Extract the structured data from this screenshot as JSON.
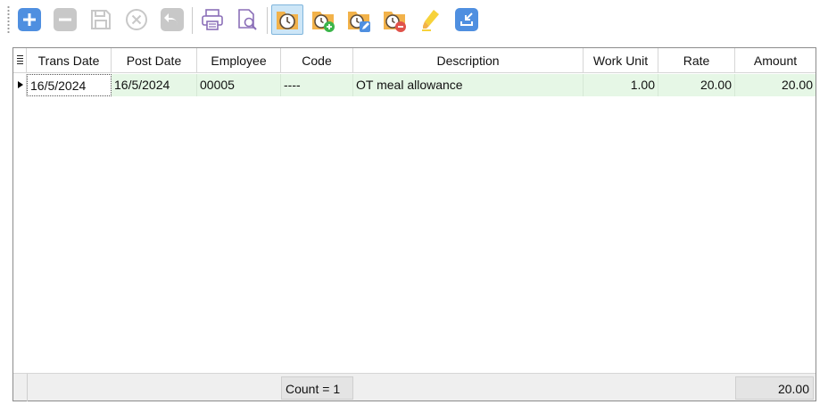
{
  "toolbar": {
    "buttons": [
      {
        "name": "add",
        "icon": "plus-icon",
        "enabled": true
      },
      {
        "name": "delete",
        "icon": "minus-icon",
        "enabled": false
      },
      {
        "name": "save",
        "icon": "save-icon",
        "enabled": false
      },
      {
        "name": "cancel",
        "icon": "cancel-icon",
        "enabled": false
      },
      {
        "name": "undo",
        "icon": "undo-icon",
        "enabled": false
      },
      {
        "name": "print",
        "icon": "printer-icon",
        "enabled": true
      },
      {
        "name": "print-preview",
        "icon": "preview-icon",
        "enabled": true
      },
      {
        "name": "overtime",
        "icon": "clock-folder-icon",
        "enabled": true,
        "active": true
      },
      {
        "name": "overtime-add",
        "icon": "clock-folder-add-icon",
        "enabled": true
      },
      {
        "name": "overtime-edit",
        "icon": "clock-folder-edit-icon",
        "enabled": true
      },
      {
        "name": "overtime-delete",
        "icon": "clock-folder-delete-icon",
        "enabled": true
      },
      {
        "name": "highlight",
        "icon": "highlighter-icon",
        "enabled": true
      },
      {
        "name": "import",
        "icon": "import-icon",
        "enabled": true
      }
    ],
    "colors": {
      "accent": "#4f8fe0",
      "disabled": "#c8c8c8",
      "folder": "#f2b24a"
    }
  },
  "grid": {
    "columns": [
      "Trans Date",
      "Post Date",
      "Employee",
      "Code",
      "Description",
      "Work Unit",
      "Rate",
      "Amount"
    ],
    "rows": [
      [
        "16/5/2024",
        "16/5/2024",
        "00005",
        "----",
        "OT meal allowance",
        "1.00",
        "20.00",
        "20.00"
      ]
    ],
    "footer": {
      "count": "Count = 1",
      "total": "20.00"
    },
    "colors": {
      "row_bg": "#e6f7e6",
      "footer_bg": "#efefef"
    }
  }
}
